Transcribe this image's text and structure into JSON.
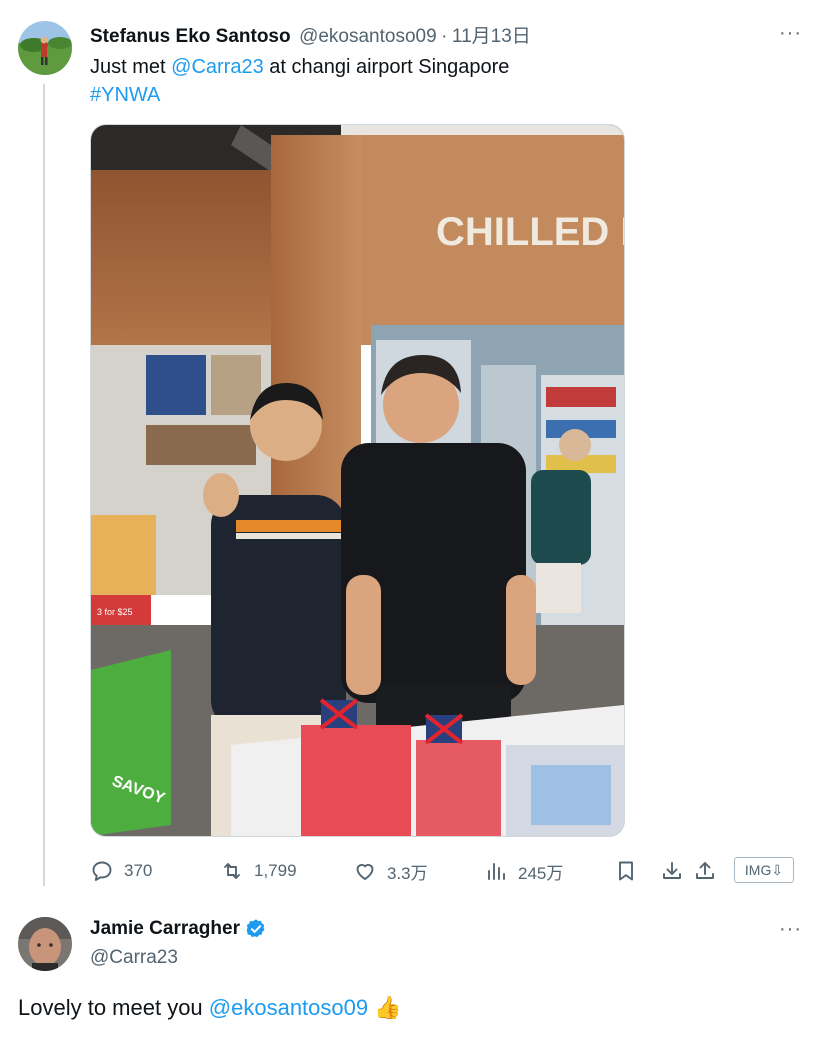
{
  "tweet": {
    "author_name": "Stefanus Eko Santoso",
    "author_handle": "@ekosantoso09",
    "separator": "·",
    "date": "11月13日",
    "text_prefix": "Just met ",
    "mention": "@Carra23",
    "text_suffix": " at changi airport Singapore",
    "hashtag": "#YNWA",
    "photo_sign": "CHILLED D",
    "photo_price_tag": "3 for $25",
    "photo_snack_label": "SAVOY",
    "actions": {
      "replies": "370",
      "retweets": "1,799",
      "likes": "3.3万",
      "views": "245万"
    },
    "img_button": "IMG⇩"
  },
  "reply": {
    "author_name": "Jamie Carragher",
    "author_handle": "@Carra23",
    "text_prefix": "Lovely to meet you ",
    "mention": "@ekosantoso09",
    "emoji": "👍"
  },
  "more_label": "···",
  "colors": {
    "link": "#1d9bf0",
    "secondary_text": "#536471",
    "verified": "#1d9bf0",
    "thread_line": "#cfd9de"
  }
}
